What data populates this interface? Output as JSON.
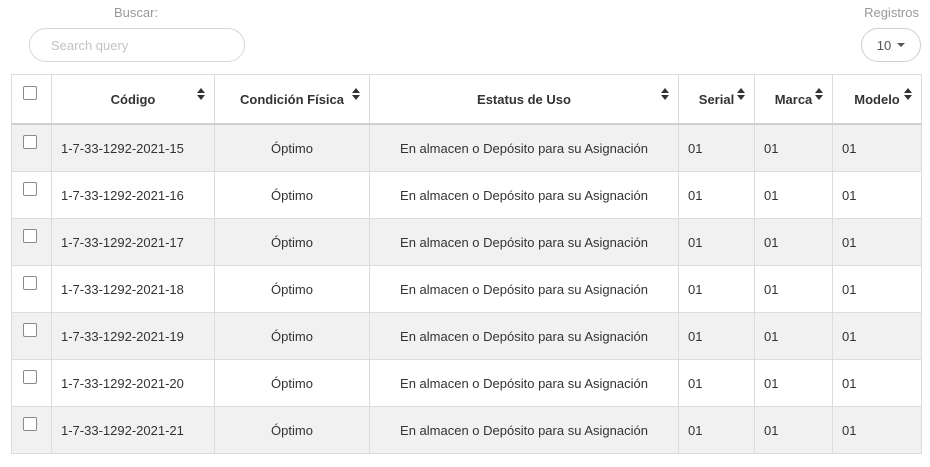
{
  "search": {
    "label": "Buscar:",
    "placeholder": "Search query"
  },
  "records": {
    "label": "Registros",
    "value": "10"
  },
  "table": {
    "headers": [
      "Código",
      "Condición Física",
      "Estatus de Uso",
      "Serial",
      "Marca",
      "Modelo"
    ],
    "rows": [
      [
        "1-7-33-1292-2021-15",
        "Óptimo",
        "En almacen o Depósito para su Asignación",
        "01",
        "01",
        "01"
      ],
      [
        "1-7-33-1292-2021-16",
        "Óptimo",
        "En almacen o Depósito para su Asignación",
        "01",
        "01",
        "01"
      ],
      [
        "1-7-33-1292-2021-17",
        "Óptimo",
        "En almacen o Depósito para su Asignación",
        "01",
        "01",
        "01"
      ],
      [
        "1-7-33-1292-2021-18",
        "Óptimo",
        "En almacen o Depósito para su Asignación",
        "01",
        "01",
        "01"
      ],
      [
        "1-7-33-1292-2021-19",
        "Óptimo",
        "En almacen o Depósito para su Asignación",
        "01",
        "01",
        "01"
      ],
      [
        "1-7-33-1292-2021-20",
        "Óptimo",
        "En almacen o Depósito para su Asignación",
        "01",
        "01",
        "01"
      ],
      [
        "1-7-33-1292-2021-21",
        "Óptimo",
        "En almacen o Depósito para su Asignación",
        "01",
        "01",
        "01"
      ]
    ]
  }
}
